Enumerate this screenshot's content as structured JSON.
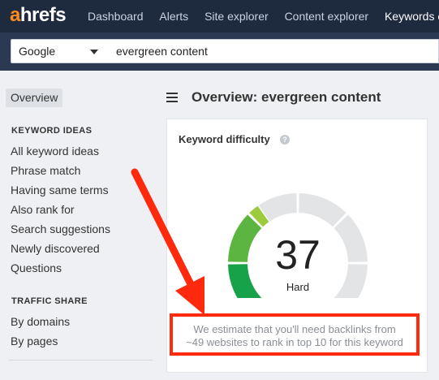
{
  "nav": {
    "logo_a": "a",
    "logo_rest": "hrefs",
    "links": [
      "Dashboard",
      "Alerts",
      "Site explorer",
      "Content explorer",
      "Keywords explorer"
    ]
  },
  "search": {
    "engine": "Google",
    "query": "evergreen content"
  },
  "sidebar": {
    "overview_label": "Overview",
    "keyword_ideas_heading": "KEYWORD IDEAS",
    "keyword_ideas": [
      "All keyword ideas",
      "Phrase match",
      "Having same terms",
      "Also rank for",
      "Search suggestions",
      "Newly discovered",
      "Questions"
    ],
    "traffic_share_heading": "TRAFFIC SHARE",
    "traffic_share": [
      "By domains",
      "By pages"
    ]
  },
  "main": {
    "title": "Overview: evergreen content"
  },
  "kd_card": {
    "title": "Keyword difficulty",
    "help_glyph": "?",
    "value": "37",
    "value_fraction": 0.37,
    "rating": "Hard",
    "estimate_line1": "We estimate that you'll need backlinks from",
    "estimate_line2": "~49 websites to rank in top 10 for this keyword"
  },
  "colors": {
    "nav_bg": "#1e2a3e",
    "logo_accent": "#ff8a1f",
    "gauge_track": "#e3e4e6",
    "gauge_green_dark": "#17a24a",
    "gauge_green_light": "#9ccb3b",
    "annotation_red": "#ff2a0e"
  },
  "icons": {
    "menu": "hamburger-menu-icon",
    "help": "question-circle-icon",
    "select_caret": "chevron-down-icon"
  }
}
